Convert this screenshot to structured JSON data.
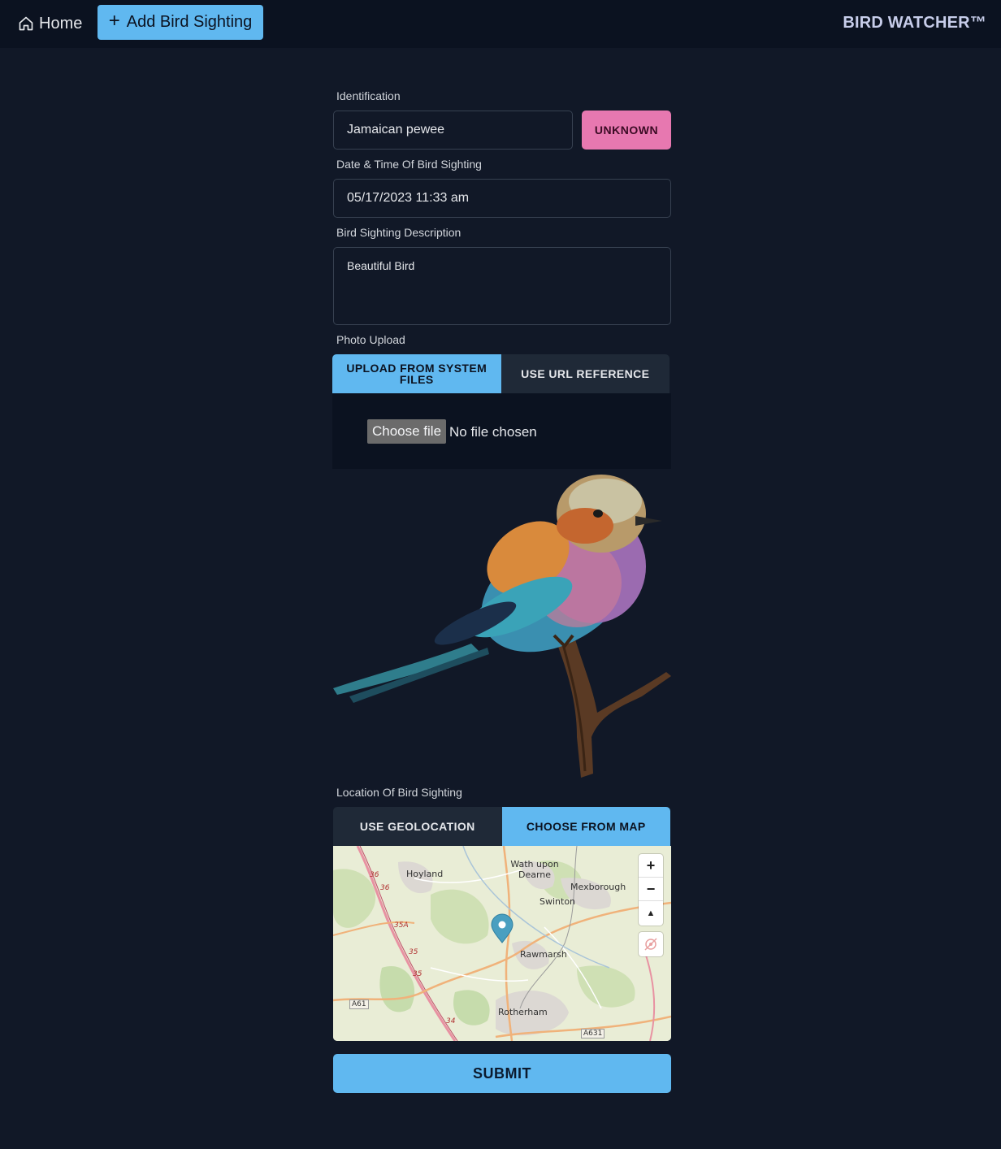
{
  "nav": {
    "home_label": "Home",
    "home_icon": "home-icon",
    "add_label": "Add Bird Sighting",
    "add_icon": "plus-icon",
    "brand": "BIRD WATCHER™"
  },
  "form": {
    "identification": {
      "label": "Identification",
      "value": "Jamaican pewee",
      "unknown_button": "UNKNOWN"
    },
    "datetime": {
      "label": "Date & Time Of Bird Sighting",
      "value": "05/17/2023 11:33 am"
    },
    "description": {
      "label": "Bird Sighting Description",
      "value": "Beautiful Bird"
    },
    "photo": {
      "label": "Photo Upload",
      "tabs": [
        {
          "label": "UPLOAD FROM SYSTEM FILES",
          "active": true
        },
        {
          "label": "USE URL REFERENCE",
          "active": false
        }
      ],
      "choose_file": "Choose file",
      "no_file": "No file chosen"
    },
    "location": {
      "label": "Location Of Bird Sighting",
      "tabs": [
        {
          "label": "USE GEOLOCATION",
          "active": false
        },
        {
          "label": "CHOOSE FROM MAP",
          "active": true
        }
      ],
      "map": {
        "places": [
          "Hoyland",
          "Wath upon Dearne",
          "Mexborough",
          "Swinton",
          "Rawmarsh",
          "Rotherham"
        ],
        "roads": [
          "36",
          "36",
          "35A",
          "35",
          "35",
          "34",
          "A61",
          "A631"
        ],
        "zoom_in": "+",
        "zoom_out": "−",
        "compass": "▲"
      }
    },
    "submit": "SUBMIT"
  },
  "colors": {
    "background": "#111827",
    "navbar": "#0b1220",
    "accent": "#60b8f0",
    "unknown": "#e778b0"
  }
}
